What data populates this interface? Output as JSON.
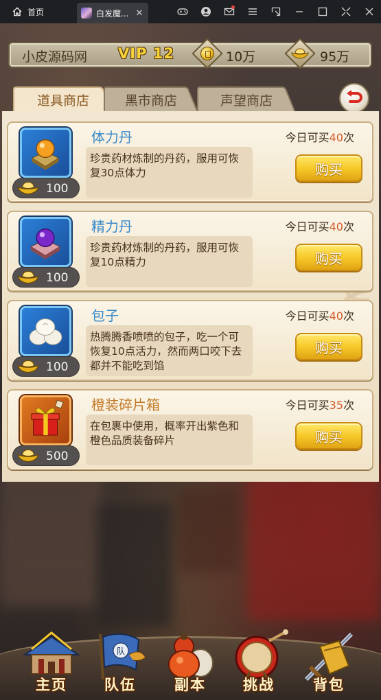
{
  "window": {
    "home_tab": "首页",
    "game_tab": "白发魔...",
    "tab_close": "✕"
  },
  "header": {
    "site_name": "小皮源码网",
    "vip": "VIP 12",
    "coins": "10万",
    "ingots": "95万"
  },
  "tabs": [
    {
      "label": "道具商店",
      "active": true
    },
    {
      "label": "黑市商店",
      "active": false
    },
    {
      "label": "声望商店",
      "active": false
    }
  ],
  "items": [
    {
      "name": "体力丹",
      "icon": "orange-pill-icon",
      "price": "100",
      "limit_prefix": "今日可买",
      "limit_count": "40",
      "limit_suffix": "次",
      "desc": "珍贵药材炼制的丹药，服用可恢复30点体力",
      "buy": "购买"
    },
    {
      "name": "精力丹",
      "icon": "purple-pill-icon",
      "price": "100",
      "limit_prefix": "今日可买",
      "limit_count": "40",
      "limit_suffix": "次",
      "desc": "珍贵药材炼制的丹药，服用可恢复10点精力",
      "buy": "购买"
    },
    {
      "name": "包子",
      "icon": "steamed-bun-icon",
      "price": "100",
      "limit_prefix": "今日可买",
      "limit_count": "40",
      "limit_suffix": "次",
      "desc": "热腾腾香喷喷的包子，吃一个可恢复10点活力，然而两口咬下去都并不能吃到馅",
      "buy": "购买"
    },
    {
      "name": "橙装碎片箱",
      "icon": "gift-box-icon",
      "price": "500",
      "limit_prefix": "今日可买",
      "limit_count": "35",
      "limit_suffix": "次",
      "desc": "在包裹中使用，概率开出紫色和橙色品质装备碎片",
      "buy": "购买"
    }
  ],
  "nav": [
    {
      "label": "主页",
      "icon": "palace-icon"
    },
    {
      "label": "队伍",
      "icon": "banner-icon"
    },
    {
      "label": "副本",
      "icon": "gourd-icon"
    },
    {
      "label": "挑战",
      "icon": "drum-icon"
    },
    {
      "label": "背包",
      "icon": "sword-pack-icon"
    }
  ],
  "colors": {
    "accent_gold": "#f7c92a",
    "name_blue": "#3a8ac8",
    "name_orange": "#c27a28",
    "limit_count": "#d05a2a"
  }
}
